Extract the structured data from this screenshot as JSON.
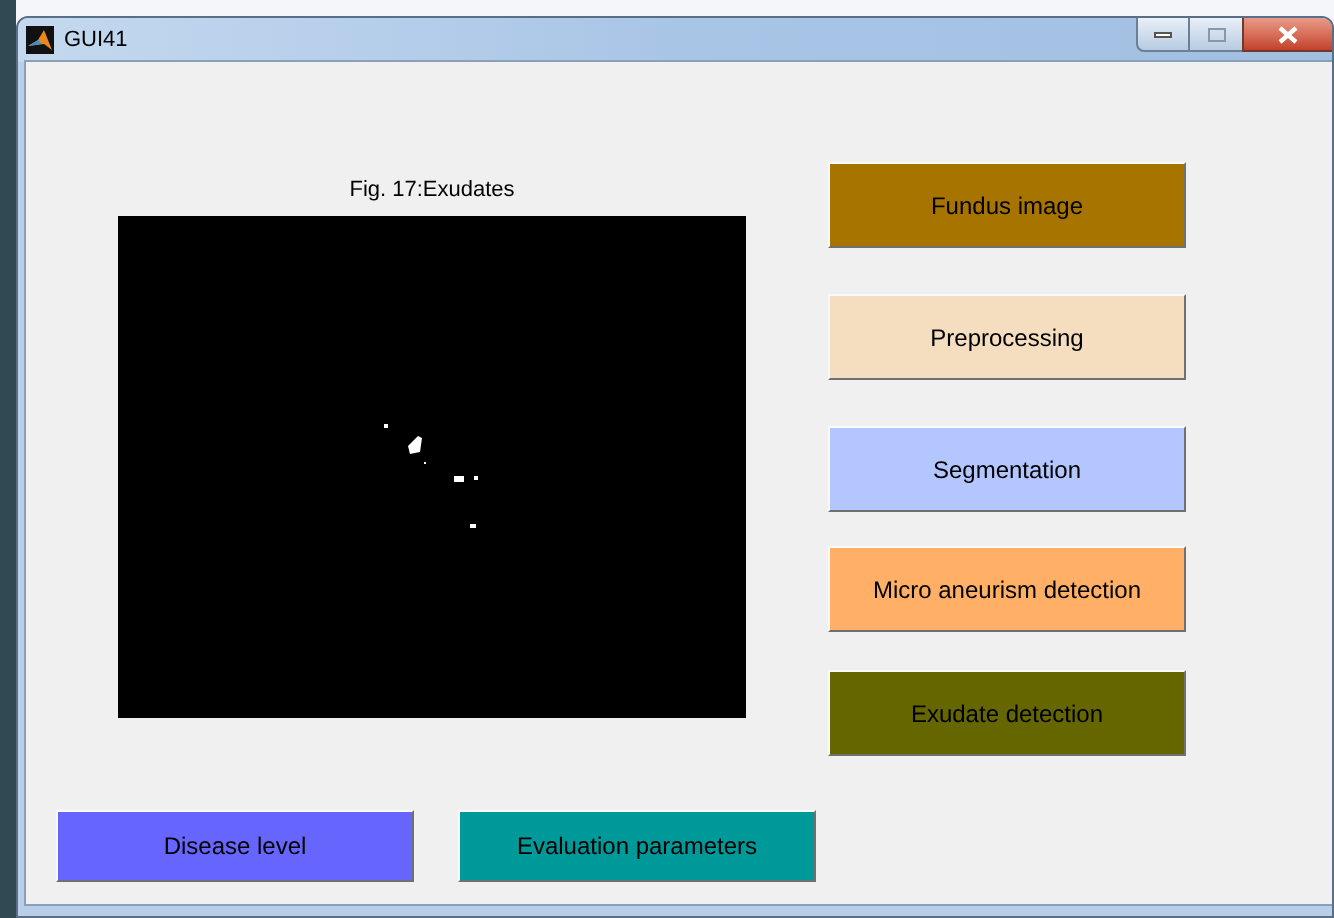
{
  "window": {
    "title": "GUI41"
  },
  "figure": {
    "title": "Fig. 17:Exudates",
    "kind": "picture"
  },
  "side_buttons": [
    {
      "label": "Fundus image",
      "color": "#a87400"
    },
    {
      "label": "Preprocessing",
      "color": "#f5dec0"
    },
    {
      "label": "Segmentation",
      "color": "#b3c6ff"
    },
    {
      "label": "Micro aneurism detection",
      "color": "#ffb066"
    },
    {
      "label": "Exudate detection",
      "color": "#666600"
    }
  ],
  "bottom_buttons": [
    {
      "label": "Disease level",
      "color": "#6666ff"
    },
    {
      "label": "Evaluation parameters",
      "color": "#009999"
    }
  ]
}
